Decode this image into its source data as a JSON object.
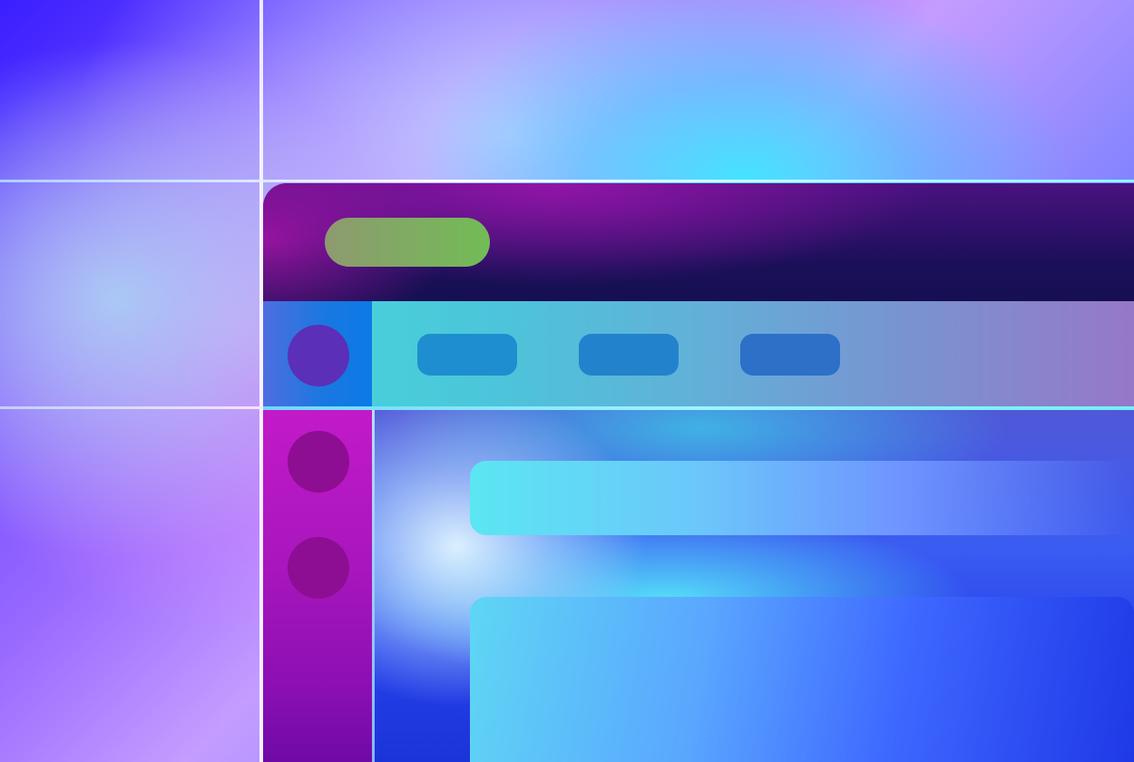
{
  "colors": {
    "background": [
      "#3a1fff",
      "#9b6bff",
      "#c59cff",
      "#2a42e8"
    ],
    "window_header": [
      "#4a1280",
      "#160f52"
    ],
    "header_pill": [
      "#8e9a70",
      "#72bc55"
    ],
    "toolbar": [
      "#45d8dc",
      "#9678c8"
    ],
    "toolbar_rail": "#0c7ae6",
    "toolbar_avatar": "#5b2fb8",
    "toolbar_tab": "#1f8ed0",
    "sidebar": [
      "#c21ac8",
      "#6e0aa6"
    ],
    "sidebar_icon": "#8d0e92",
    "content": [
      "#5058d8",
      "#1a34d8"
    ],
    "content_card": [
      "#5be6f2",
      "#1e38e6"
    ]
  },
  "window": {
    "header": {
      "pill_icon": "placeholder-pill"
    },
    "toolbar": {
      "avatar_icon": "avatar-circle",
      "tabs": [
        {
          "id": "tab-1"
        },
        {
          "id": "tab-2"
        },
        {
          "id": "tab-3"
        }
      ]
    },
    "sidebar": {
      "items": [
        {
          "icon": "circle-icon"
        },
        {
          "icon": "circle-icon"
        }
      ]
    },
    "content": {
      "cards": [
        {
          "id": "card-1"
        },
        {
          "id": "card-2"
        }
      ]
    }
  }
}
